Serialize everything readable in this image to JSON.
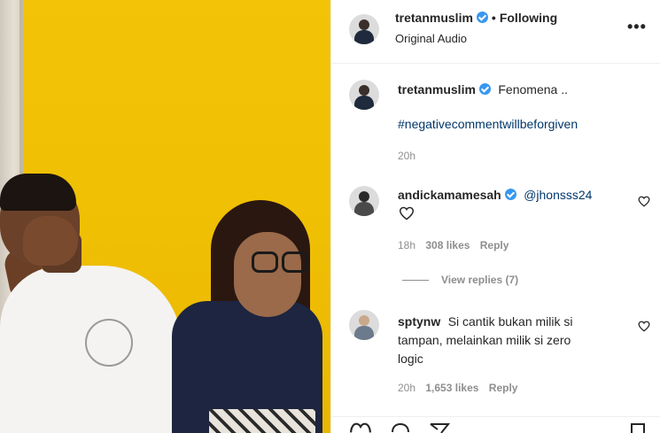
{
  "header": {
    "username": "tretanmuslim",
    "dot": "•",
    "follow_label": "Following",
    "audio": "Original Audio",
    "more": "•••"
  },
  "caption": {
    "username": "tretanmuslim",
    "text": "Fenomena ..",
    "hashtag": "#negativecommentwillbeforgiven",
    "time": "20h"
  },
  "comments": [
    {
      "username": "andickamamesah",
      "mention": "@jhonsss24",
      "time": "18h",
      "likes": "308 likes",
      "reply": "Reply",
      "view_replies": "View replies (7)"
    },
    {
      "username": "sptynw",
      "text_line1": "Si cantik bukan milik si",
      "text_line2": "tampan, melainkan milik si zero",
      "text_line3": "logic",
      "time": "20h",
      "likes": "1,653 likes",
      "reply": "Reply"
    }
  ],
  "colors": {
    "verified": "#3897f0",
    "link": "#00376b",
    "muted": "#8e8e8e",
    "wall": "#f2c306"
  },
  "icons": [
    "heart-icon",
    "comment-icon",
    "share-icon",
    "bookmark-icon",
    "more-icon",
    "verified-badge-icon"
  ]
}
